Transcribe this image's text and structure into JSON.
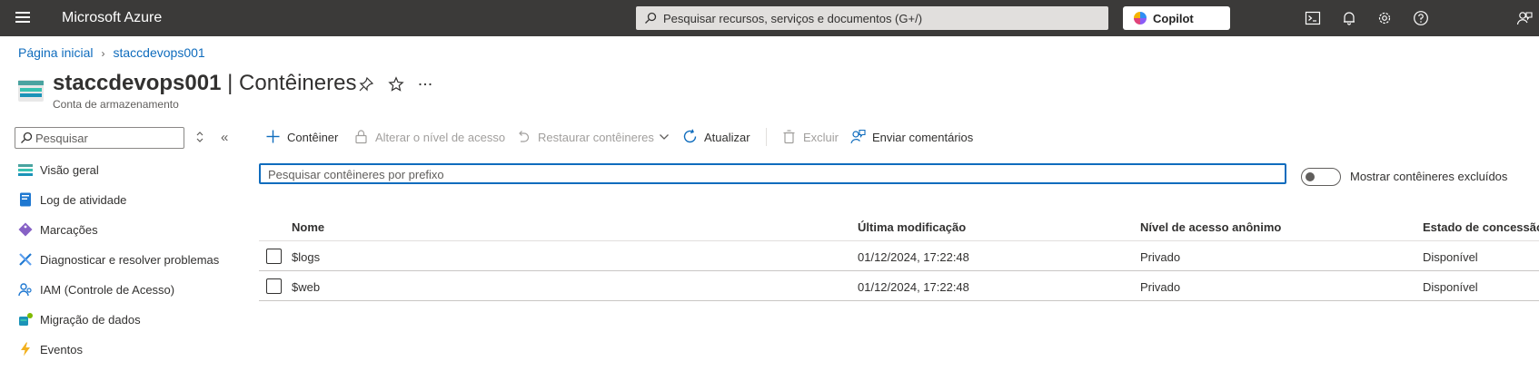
{
  "topbar": {
    "brand": "Microsoft Azure",
    "search_placeholder": "Pesquisar recursos, serviços e documentos (G+/)",
    "copilot_label": "Copilot",
    "icons": [
      "hamburger-menu-icon",
      "cloud-shell-icon",
      "notifications-icon",
      "settings-icon",
      "help-icon",
      "feedback-icon"
    ]
  },
  "breadcrumb": {
    "home": "Página inicial",
    "resource": "staccdevops001"
  },
  "header": {
    "resource_name": "staccdevops001",
    "separator": " | ",
    "blade_name": "Contêineres",
    "subtitle": "Conta de armazenamento"
  },
  "nav": {
    "search_placeholder": "Pesquisar",
    "collapse_glyph": "«",
    "items": [
      {
        "label": "Visão geral",
        "icon": "overview-icon"
      },
      {
        "label": "Log de atividade",
        "icon": "activity-log-icon"
      },
      {
        "label": "Marcações",
        "icon": "tags-icon"
      },
      {
        "label": "Diagnosticar e resolver problemas",
        "icon": "diagnose-icon"
      },
      {
        "label": "IAM (Controle de Acesso)",
        "icon": "iam-icon"
      },
      {
        "label": "Migração de dados",
        "icon": "data-migration-icon"
      },
      {
        "label": "Eventos",
        "icon": "events-icon"
      }
    ]
  },
  "toolbar": {
    "add_container": "Contêiner",
    "change_access": "Alterar o nível de acesso",
    "restore": "Restaurar contêineres",
    "refresh": "Atualizar",
    "delete": "Excluir",
    "feedback": "Enviar comentários"
  },
  "filter": {
    "placeholder": "Pesquisar contêineres por prefixo",
    "show_deleted_label": "Mostrar contêineres excluídos",
    "show_deleted_on": false
  },
  "table": {
    "columns": [
      "Nome",
      "Última modificação",
      "Nível de acesso anônimo",
      "Estado de concessão"
    ],
    "rows": [
      {
        "name": "$logs",
        "modified": "01/12/2024, 17:22:48",
        "access": "Privado",
        "lease": "Disponível"
      },
      {
        "name": "$web",
        "modified": "01/12/2024, 17:22:48",
        "access": "Privado",
        "lease": "Disponível"
      }
    ]
  },
  "colors": {
    "topbar_bg": "#3b3a39",
    "link": "#0f6cbd",
    "focus_border": "#0f6cbd"
  }
}
